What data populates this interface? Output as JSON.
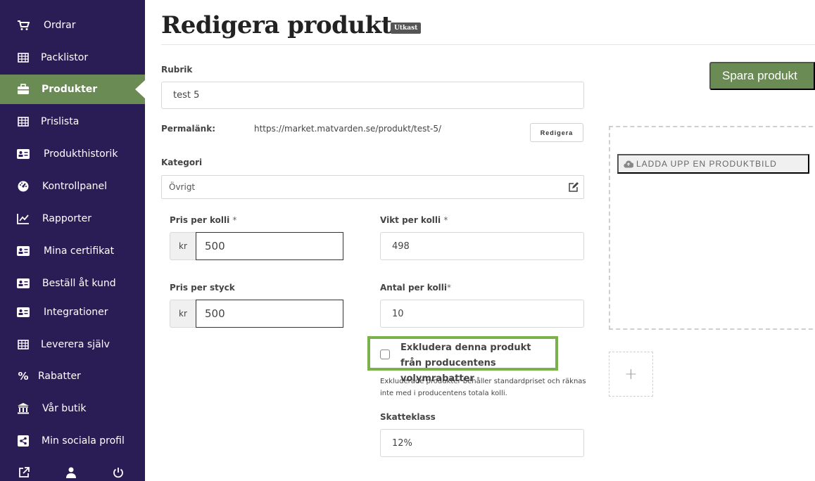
{
  "sidebar": {
    "items": [
      {
        "label": "Ordrar",
        "icon": "cart-icon",
        "active": false
      },
      {
        "label": "Packlistor",
        "icon": "table-icon",
        "active": false
      },
      {
        "label": "Produkter",
        "icon": "briefcase-icon",
        "active": true
      },
      {
        "label": "Prislista",
        "icon": "table-icon",
        "active": false
      },
      {
        "label": "Produkthistorik",
        "icon": "id-card-icon",
        "active": false
      },
      {
        "label": "Kontrollpanel",
        "icon": "dashboard-icon",
        "active": false
      },
      {
        "label": "Rapporter",
        "icon": "line-chart-icon",
        "active": false
      },
      {
        "label": "Mina certifikat",
        "icon": "id-card-icon",
        "active": false
      },
      {
        "label": "Beställ åt kund",
        "icon": "id-card-icon",
        "active": false
      },
      {
        "label": "Integrationer",
        "icon": "id-card-icon",
        "active": false
      },
      {
        "label": "Leverera själv",
        "icon": "table-icon",
        "active": false
      },
      {
        "label": "Rabatter",
        "icon": "percent-icon",
        "active": false
      },
      {
        "label": "Vår butik",
        "icon": "bank-icon",
        "active": false
      },
      {
        "label": "Min sociala profil",
        "icon": "share-icon",
        "active": false
      }
    ],
    "bottom_icons": [
      "external-link-icon",
      "user-icon",
      "power-icon"
    ],
    "background": "#2a1d56",
    "active_color": "#6a8b53"
  },
  "header": {
    "title": "Redigera produkt",
    "badge": "Utkast"
  },
  "form": {
    "rubrik_label": "Rubrik",
    "rubrik_value": "test 5",
    "permalink_label": "Permalänk:",
    "permalink_url": "https://market.matvarden.se/produkt/test-5/",
    "permalink_edit": "Redigera",
    "kategori_label": "Kategori",
    "kategori_value": "Övrigt",
    "pris_kolli_label": "Pris per kolli",
    "pris_kolli_req": "*",
    "pris_kolli_prefix": "kr",
    "pris_kolli_value": "500",
    "vikt_kolli_label": "Vikt per kolli",
    "vikt_kolli_req": "*",
    "vikt_kolli_value": "498",
    "pris_styck_label": "Pris per styck",
    "pris_styck_prefix": "kr",
    "pris_styck_value": "500",
    "antal_kolli_label": "Antal per kolli",
    "antal_kolli_req": "*",
    "antal_kolli_value": "10",
    "exclude_label": "Exkludera denna produkt från producentens volymrabatter",
    "exclude_checked": false,
    "exclude_help": "Exkluderade produkter behåller standardpriset och räknas inte med i producentens totala kolli.",
    "skatteklass_label": "Skatteklass",
    "skatteklass_value": "12%"
  },
  "actions": {
    "save_label": "Spara produkt",
    "upload_label": "LADDA UPP EN PRODUKTBILD",
    "add_image": "+"
  },
  "colors": {
    "accent": "#6a8b53",
    "highlight": "#7ab14a"
  }
}
